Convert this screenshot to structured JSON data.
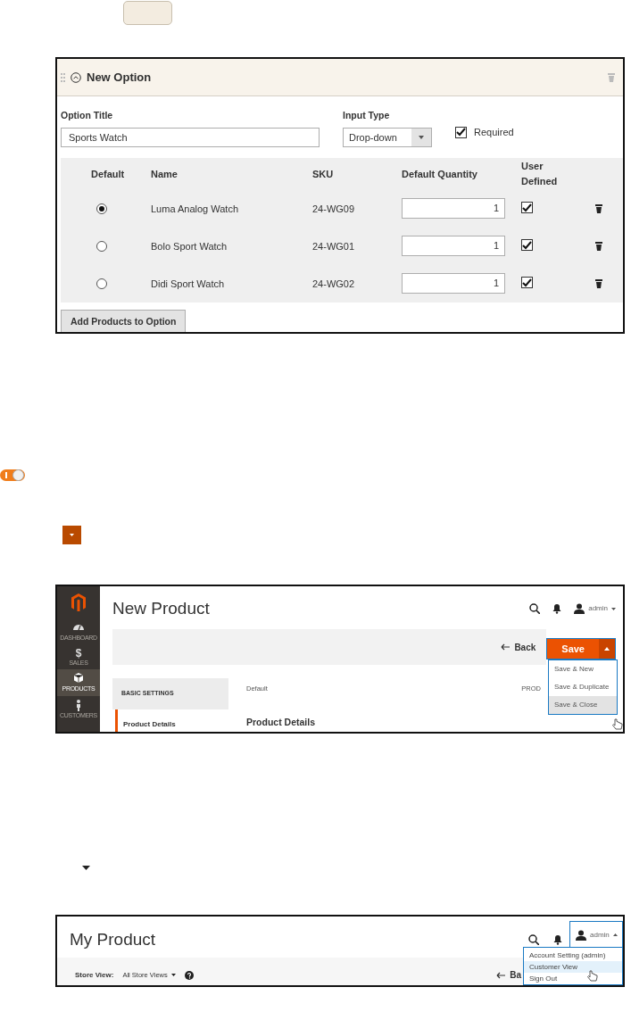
{
  "option_panel": {
    "title": "New Option",
    "option_title": {
      "label": "Option Title",
      "value": "Sports Watch"
    },
    "input_type": {
      "label": "Input Type",
      "value": "Drop-down"
    },
    "required": {
      "label": "Required",
      "checked": true
    },
    "columns": [
      "Default",
      "Name",
      "SKU",
      "Default Quantity",
      "User Defined"
    ],
    "rows": [
      {
        "selected": true,
        "name": "Luma Analog Watch",
        "sku": "24-WG09",
        "quantity": "1",
        "user_defined": true
      },
      {
        "selected": false,
        "name": "Bolo Sport Watch",
        "sku": "24-WG01",
        "quantity": "1",
        "user_defined": true
      },
      {
        "selected": false,
        "name": "Didi Sport Watch",
        "sku": "24-WG02",
        "quantity": "1",
        "user_defined": true
      }
    ],
    "add_button": "Add Products to Option"
  },
  "toggle": {
    "on": true
  },
  "product_panel": {
    "sidebar": [
      {
        "kind": "gauge",
        "label": "DASHBOARD",
        "selected": false
      },
      {
        "kind": "dollar",
        "icon": "$",
        "label": "SALES",
        "selected": false
      },
      {
        "kind": "box",
        "label": "PRODUCTS",
        "selected": true
      },
      {
        "kind": "person",
        "label": "CUSTOMERS",
        "selected": false
      }
    ],
    "title": "New Product",
    "user": "admin",
    "back": "Back",
    "save": "Save",
    "save_menu": [
      {
        "label": "Save & New",
        "selected": false
      },
      {
        "label": "Save & Duplicate",
        "selected": false
      },
      {
        "label": "Save & Close",
        "selected": true
      }
    ],
    "tab": "BASIC SETTINGS",
    "scope": "Default",
    "column_3": "PROD",
    "nav_item": "Product Details",
    "section_title": "Product Details"
  },
  "account_panel": {
    "title": "My Product",
    "user": "admin",
    "user_menu": [
      {
        "label": "Account Setting (admin)",
        "selected": false
      },
      {
        "label": "Customer View",
        "selected": true
      },
      {
        "label": "Sign Out",
        "selected": false
      }
    ],
    "store_view": {
      "label": "Store View:",
      "value": "All Store Views"
    },
    "back": "Ba"
  }
}
